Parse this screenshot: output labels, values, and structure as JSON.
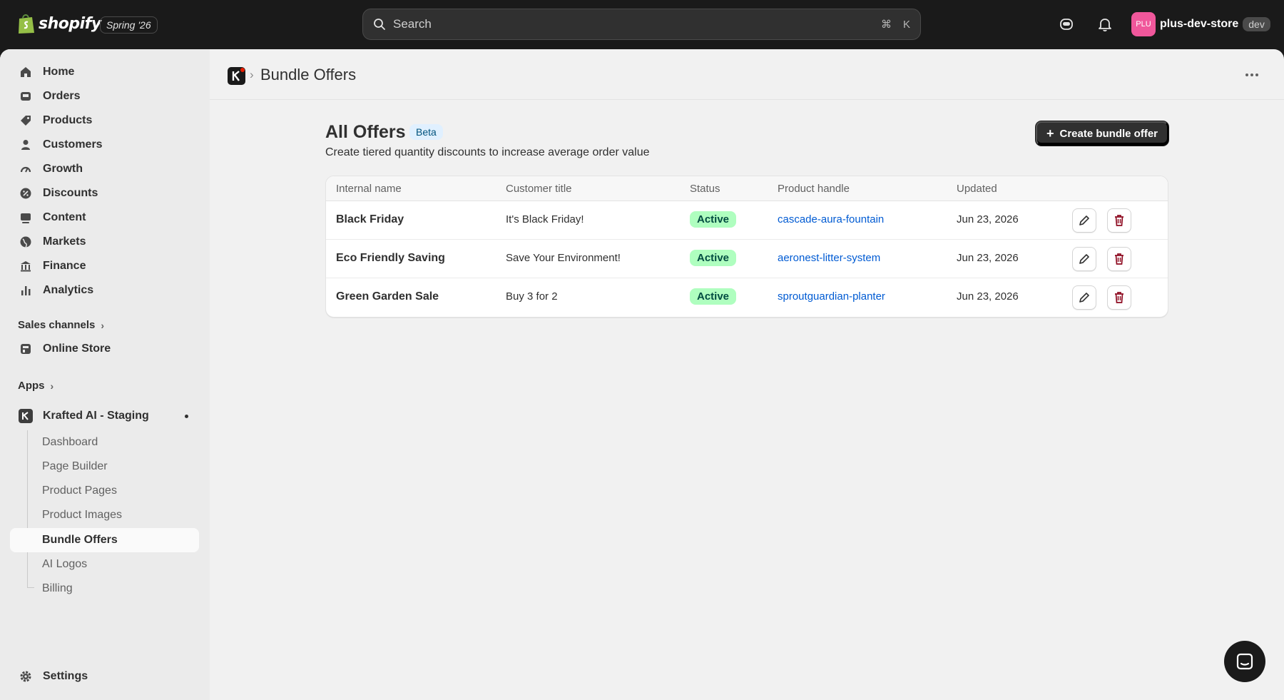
{
  "topbar": {
    "brand": "shopify",
    "release": "Spring '26",
    "search_placeholder": "Search",
    "shortcut_cmd": "⌘",
    "shortcut_key": "K",
    "store_initials": "PLU",
    "store_name": "plus-dev-store",
    "store_tag": "dev"
  },
  "sidebar": {
    "items": [
      {
        "label": "Home",
        "icon": "home-icon"
      },
      {
        "label": "Orders",
        "icon": "inbox-icon"
      },
      {
        "label": "Products",
        "icon": "tag-icon"
      },
      {
        "label": "Customers",
        "icon": "person-icon"
      },
      {
        "label": "Growth",
        "icon": "gauge-icon"
      },
      {
        "label": "Discounts",
        "icon": "discount-icon"
      },
      {
        "label": "Content",
        "icon": "image-icon"
      },
      {
        "label": "Markets",
        "icon": "globe-icon"
      },
      {
        "label": "Finance",
        "icon": "bank-icon"
      },
      {
        "label": "Analytics",
        "icon": "bar-chart-icon"
      }
    ],
    "sales_channels_label": "Sales channels",
    "online_store": "Online Store",
    "apps_label": "Apps",
    "app_name": "Krafted AI - Staging",
    "app_subitems": [
      "Dashboard",
      "Page Builder",
      "Product Pages",
      "Product Images",
      "Bundle Offers",
      "AI Logos",
      "Billing"
    ],
    "settings": "Settings"
  },
  "page": {
    "breadcrumb_title": "Bundle Offers",
    "heading": "All Offers",
    "beta": "Beta",
    "subheading": "Create tiered quantity discounts to increase average order value",
    "create_button": "Create bundle offer"
  },
  "table": {
    "columns": [
      "Internal name",
      "Customer title",
      "Status",
      "Product handle",
      "Updated"
    ],
    "rows": [
      {
        "name": "Black Friday",
        "title": "It's Black Friday!",
        "status": "Active",
        "handle": "cascade-aura-fountain",
        "updated": "Jun 23, 2026"
      },
      {
        "name": "Eco Friendly Saving",
        "title": "Save Your Environment!",
        "status": "Active",
        "handle": "aeronest-litter-system",
        "updated": "Jun 23, 2026"
      },
      {
        "name": "Green Garden Sale",
        "title": "Buy 3 for 2",
        "status": "Active",
        "handle": "sproutguardian-planter",
        "updated": "Jun 23, 2026"
      }
    ]
  },
  "colors": {
    "accent_link": "#005bd3",
    "status_bg": "#affebf",
    "danger": "#8e0b21",
    "store_avatar": "#f0579b"
  }
}
